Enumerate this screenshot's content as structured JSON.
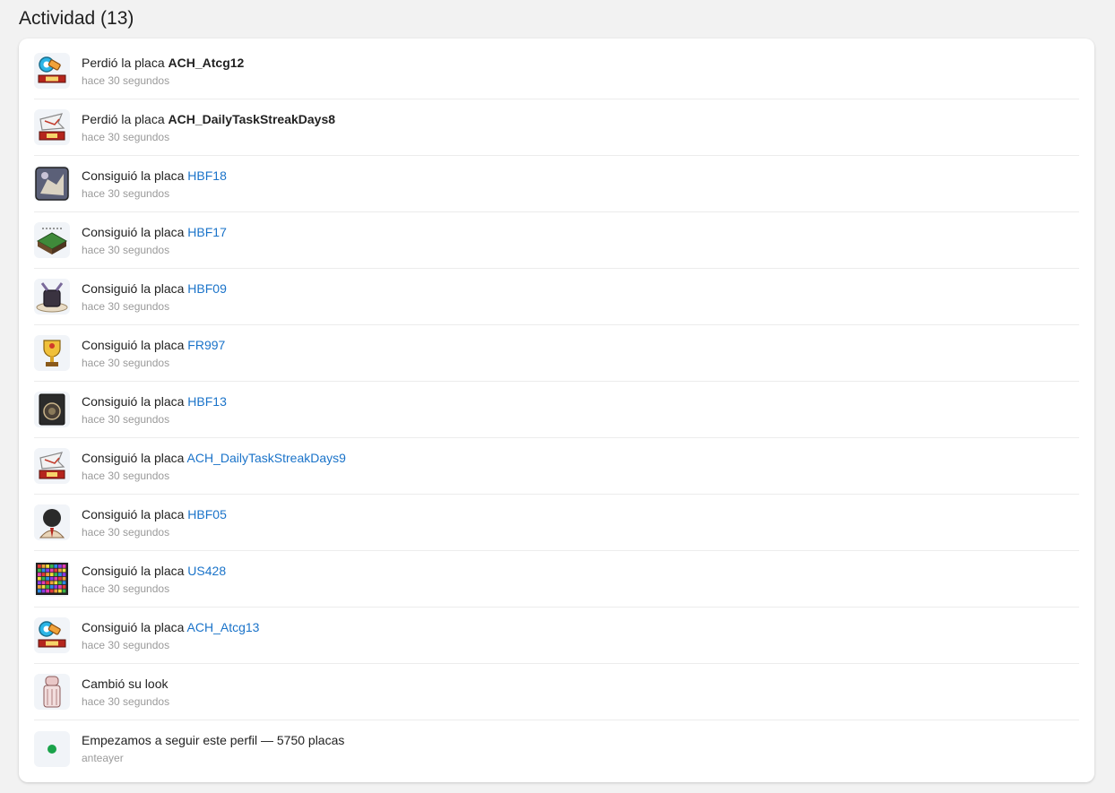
{
  "header": {
    "title": "Actividad (13)"
  },
  "activity": [
    {
      "prefix": "Perdió la placa",
      "name": "ACH_Atcg12",
      "style": "bold",
      "time": "hace 30 segundos",
      "icon": "atcg-badge-icon"
    },
    {
      "prefix": "Perdió la placa",
      "name": "ACH_DailyTaskStreakDays8",
      "style": "bold",
      "time": "hace 30 segundos",
      "icon": "daily-streak-badge-icon"
    },
    {
      "prefix": "Consiguió la placa",
      "name": "HBF18",
      "style": "link",
      "time": "hace 30 segundos",
      "icon": "hbf18-badge-icon"
    },
    {
      "prefix": "Consiguió la placa",
      "name": "HBF17",
      "style": "link",
      "time": "hace 30 segundos",
      "icon": "hbf17-badge-icon"
    },
    {
      "prefix": "Consiguió la placa",
      "name": "HBF09",
      "style": "link",
      "time": "hace 30 segundos",
      "icon": "hbf09-badge-icon"
    },
    {
      "prefix": "Consiguió la placa",
      "name": "FR997",
      "style": "link",
      "time": "hace 30 segundos",
      "icon": "trophy-badge-icon"
    },
    {
      "prefix": "Consiguió la placa",
      "name": "HBF13",
      "style": "link",
      "time": "hace 30 segundos",
      "icon": "hbf13-badge-icon"
    },
    {
      "prefix": "Consiguió la placa",
      "name": "ACH_DailyTaskStreakDays9",
      "style": "link",
      "time": "hace 30 segundos",
      "icon": "daily-streak-badge-icon"
    },
    {
      "prefix": "Consiguió la placa",
      "name": "HBF05",
      "style": "link",
      "time": "hace 30 segundos",
      "icon": "hbf05-badge-icon"
    },
    {
      "prefix": "Consiguió la placa",
      "name": "US428",
      "style": "link",
      "time": "hace 30 segundos",
      "icon": "grid-badge-icon"
    },
    {
      "prefix": "Consiguió la placa",
      "name": "ACH_Atcg13",
      "style": "link",
      "time": "hace 30 segundos",
      "icon": "atcg-badge-icon"
    },
    {
      "prefix": "Cambió su look",
      "name": "",
      "style": "none",
      "time": "hace 30 segundos",
      "icon": "avatar-look-icon"
    },
    {
      "prefix": "Empezamos a seguir este perfil — 5750 placas",
      "name": "",
      "style": "none",
      "time": "anteayer",
      "icon": "green-dot-icon"
    }
  ],
  "colors": {
    "link": "#1a73c9",
    "dot": "#1aa34a",
    "muted": "#9a9a9a"
  }
}
